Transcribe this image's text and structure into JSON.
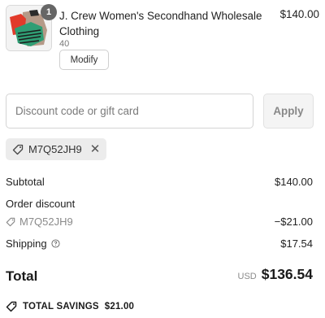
{
  "product": {
    "quantity": "1",
    "title": "J. Crew Women's Secondhand Wholesale Clothing",
    "variant": "40",
    "modify_label": "Modify",
    "price": "$140.00"
  },
  "discount": {
    "placeholder": "Discount code or gift card",
    "apply_label": "Apply",
    "applied_code": "M7Q52JH9"
  },
  "summary": {
    "subtotal_label": "Subtotal",
    "subtotal_value": "$140.00",
    "order_discount_label": "Order discount",
    "discount_code": "M7Q52JH9",
    "discount_value": "−$21.00",
    "shipping_label": "Shipping",
    "shipping_value": "$17.54",
    "total_label": "Total",
    "currency": "USD",
    "total_value": "$136.54",
    "savings_label": "TOTAL SAVINGS",
    "savings_value": "$21.00"
  },
  "icons": {
    "tag": "tag-icon",
    "close": "close-icon",
    "help": "help-circle-icon"
  },
  "colors": {
    "badge": "#666666",
    "chip_bg": "#ececec",
    "apply_bg": "#f4f4f4"
  }
}
